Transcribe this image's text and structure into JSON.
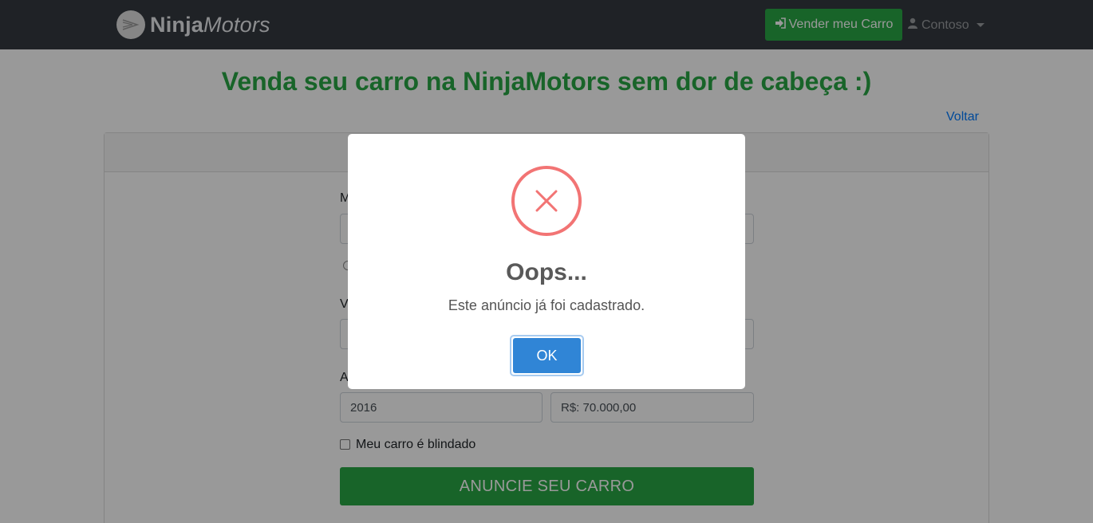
{
  "navbar": {
    "brand_bold": "Ninja",
    "brand_italic": "Motors",
    "sell_button": "Vender meu Carro",
    "user_name": "Contoso"
  },
  "page": {
    "title": "Venda seu carro na NinjaMotors sem dor de cabeça :)",
    "back_link": "Voltar"
  },
  "form": {
    "label_top_partial": "M",
    "label_middle_partial": "V",
    "label_lower_partial": "A",
    "year_value": "2016",
    "price_value": "R$: 70.000,00",
    "armored_label": "Meu carro é blindado",
    "submit_label": "ANUNCIE SEU CARRO"
  },
  "modal": {
    "icon": "error-x-icon",
    "title": "Oops...",
    "message": "Este anúncio já foi cadastrado.",
    "ok_label": "OK"
  },
  "colors": {
    "navbar": "#343a40",
    "brand_green": "#28a745",
    "link_blue": "#007bff",
    "error_red": "#f27474",
    "ok_blue": "#3085d6"
  }
}
